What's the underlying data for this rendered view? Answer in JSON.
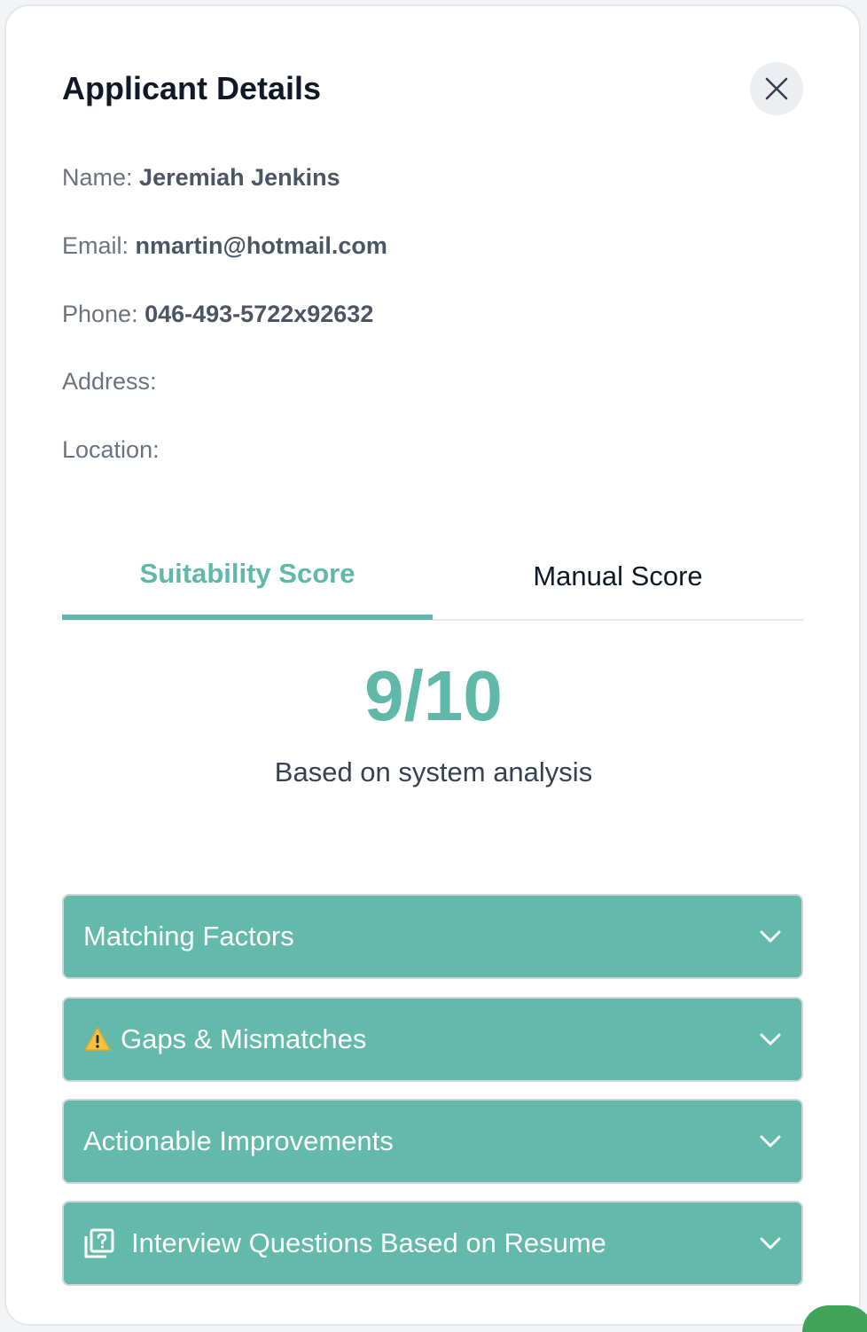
{
  "header": {
    "title": "Applicant Details",
    "close_icon": "close-icon"
  },
  "fields": {
    "name": {
      "label": "Name:",
      "value": "Jeremiah Jenkins"
    },
    "email": {
      "label": "Email:",
      "value": "nmartin@hotmail.com"
    },
    "phone": {
      "label": "Phone:",
      "value": "046-493-5722x92632"
    },
    "address": {
      "label": "Address:",
      "value": ""
    },
    "location": {
      "label": "Location:",
      "value": ""
    }
  },
  "tabs": [
    {
      "label": "Suitability Score",
      "active": true
    },
    {
      "label": "Manual Score",
      "active": false
    }
  ],
  "score": {
    "value": "9/10",
    "caption": "Based on system analysis"
  },
  "sections": [
    {
      "label": "Matching Factors",
      "icon": ""
    },
    {
      "label": "Gaps & Mismatches",
      "icon": "warning-icon"
    },
    {
      "label": "Actionable Improvements",
      "icon": ""
    },
    {
      "label": "Interview Questions Based on Resume",
      "icon": "question-cards-icon"
    }
  ],
  "colors": {
    "accent": "#5fb8a8",
    "section_bg": "#63b9aa",
    "warning": "#f5c242"
  }
}
